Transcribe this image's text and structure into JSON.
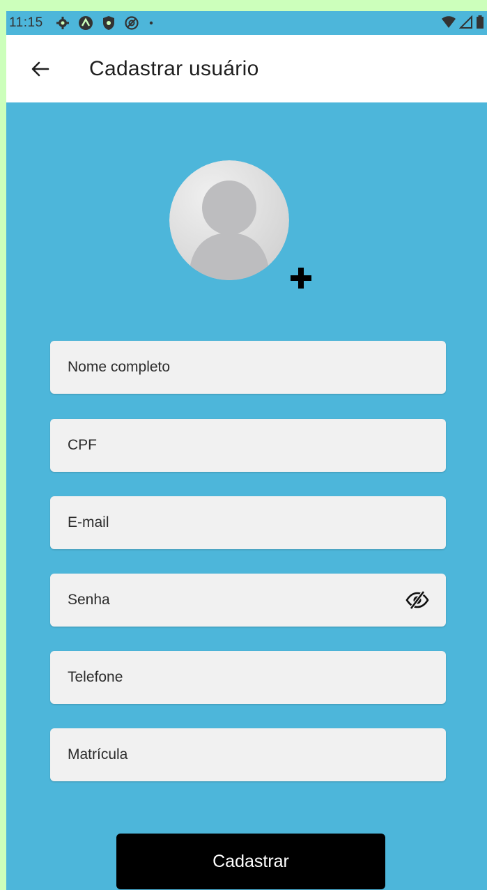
{
  "status_bar": {
    "time": "11:15",
    "icons": [
      "settings-icon",
      "notification-a-icon",
      "shield-icon",
      "sync-icon",
      "dot-icon"
    ],
    "right_icons": [
      "wifi-icon",
      "signal-icon",
      "battery-icon"
    ]
  },
  "app_bar": {
    "back_icon": "arrow-left-icon",
    "title": "Cadastrar usuário"
  },
  "avatar": {
    "icon": "user-placeholder-icon",
    "add_icon": "plus-icon"
  },
  "form": {
    "fields": [
      {
        "name": "nome",
        "placeholder": "Nome completo",
        "value": ""
      },
      {
        "name": "cpf",
        "placeholder": "CPF",
        "value": ""
      },
      {
        "name": "email",
        "placeholder": "E-mail",
        "value": ""
      },
      {
        "name": "senha",
        "placeholder": "Senha",
        "value": "",
        "trailing_icon": "eye-off-icon"
      },
      {
        "name": "telefone",
        "placeholder": "Telefone",
        "value": ""
      },
      {
        "name": "matricula",
        "placeholder": "Matrícula",
        "value": ""
      }
    ],
    "submit_label": "Cadastrar"
  },
  "colors": {
    "background": "#4db6da",
    "field_bg": "#f1f1f1",
    "button_bg": "#000000",
    "button_text": "#ffffff",
    "app_bar_bg": "#ffffff",
    "outer_border": "#ccffbb"
  }
}
